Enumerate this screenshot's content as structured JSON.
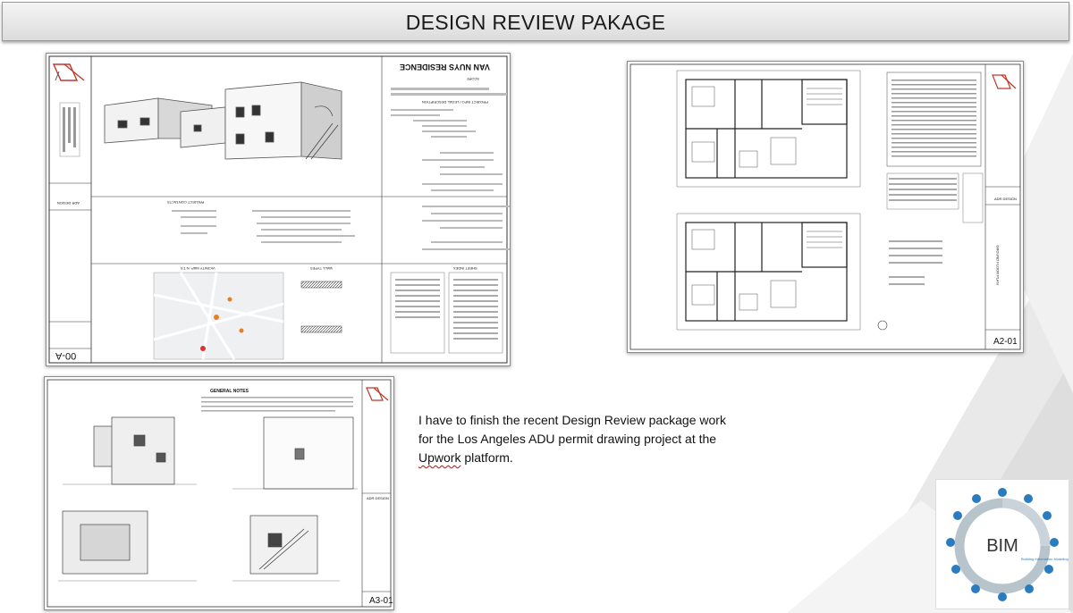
{
  "title": "DESIGN REVIEW PAKAGE",
  "note": {
    "part1": "I have to finish the recent Design Review package work for the Los Angeles ADU permit drawing project at the ",
    "part2": "Upwork",
    "part3": " platform."
  },
  "sheets": {
    "cover": {
      "id": "00-A",
      "project_title": "VAN NUYS RESIDENCE",
      "section_scope": "SCOPE",
      "section_project_info": "PROJECT INFO / LEGAL DESCRIPTION",
      "section_contacts": "PROJECT CONTACTS",
      "section_vicinity": "VICINITY MAP: N.T.S",
      "section_wall_types": "WALL TYPES",
      "section_sheet_index": "SHEET INDEX",
      "firm": "ADR DESIGN"
    },
    "floor_plan": {
      "id": "A2-01",
      "firm": "ADR DESIGN",
      "side_title": "GROUND FLOOR PLAN"
    },
    "elevations": {
      "id": "A3-01",
      "section_notes": "GENERAL NOTES",
      "firm": "ADR DESIGN"
    }
  },
  "bim": {
    "main": "BIM",
    "sub": "Building Information Modeling"
  },
  "colors": {
    "accent_logo": "#c0392b",
    "bim_blue": "#2b7bbf"
  }
}
